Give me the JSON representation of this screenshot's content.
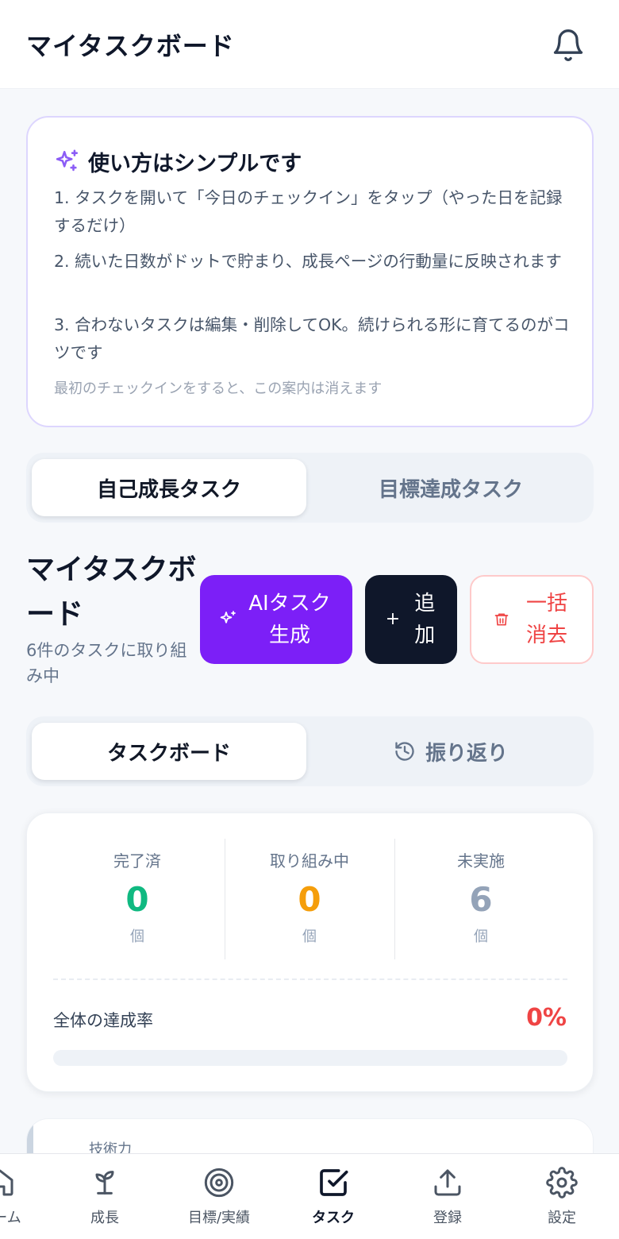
{
  "header": {
    "title": "マイタスクボード",
    "bell_icon": "bell-icon"
  },
  "guide": {
    "title": "使い方はシンプルです",
    "icon": "sparkles-icon",
    "steps": [
      "1. タスクを開いて「今日のチェックイン」をタップ（やった日を記録するだけ）",
      "2. 続いた日数がドットで貯まり、成長ページの行動量に反映されます",
      "3. 合わないタスクは編集・削除してOK。続けられる形に育てるのがコツです"
    ],
    "note": "最初のチェックインをすると、この案内は消えます"
  },
  "category_tabs": {
    "options": [
      "自己成長タスク",
      "目標達成タスク"
    ],
    "selected": "自己成長タスク"
  },
  "board": {
    "title": "マイタスクボード",
    "subtitle": "6件のタスクに取り組み中",
    "ai_button": "AIタスク生成",
    "add_button": "追加",
    "clear_button": "一括消去"
  },
  "view_tabs": {
    "options": [
      "タスクボード",
      "振り返り"
    ],
    "selected": "タスクボード",
    "history_icon": "history-icon"
  },
  "stats": {
    "items": [
      {
        "label": "完了済",
        "value": "0",
        "unit": "個",
        "color": "#10b981"
      },
      {
        "label": "取り組み中",
        "value": "0",
        "unit": "個",
        "color": "#f59e0b"
      },
      {
        "label": "未実施",
        "value": "6",
        "unit": "個",
        "color": "#94a3b8"
      }
    ],
    "rate_label": "全体の達成率",
    "rate_value": "0%",
    "rate_fraction": 0
  },
  "task_peek": {
    "category": "技術力"
  },
  "nav": {
    "items": [
      {
        "label": "ホーム",
        "icon": "home-icon"
      },
      {
        "label": "成長",
        "icon": "sprout-icon"
      },
      {
        "label": "目標/実績",
        "icon": "target-icon"
      },
      {
        "label": "タスク",
        "icon": "check-square-icon"
      },
      {
        "label": "登録",
        "icon": "upload-icon"
      },
      {
        "label": "設定",
        "icon": "gear-icon"
      }
    ],
    "active": "タスク"
  }
}
